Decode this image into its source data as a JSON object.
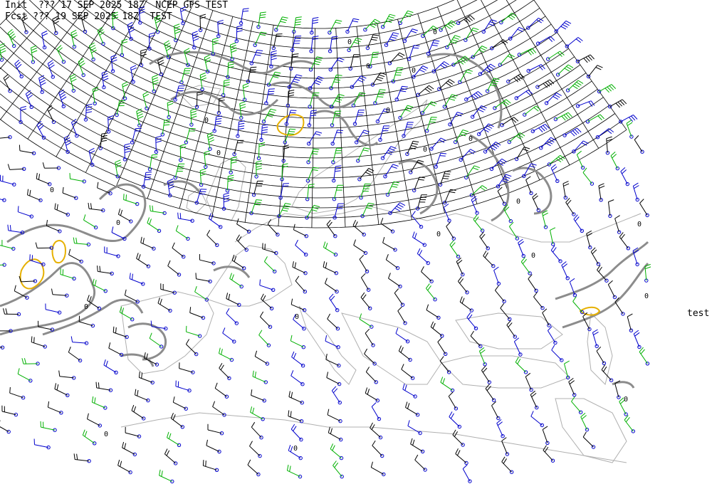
{
  "header": {
    "line1": "Init  ??? 17 SEP 2025 18Z  NCEP GFS TEST",
    "line2": "Fcst ??? 19 SEP 2025 18Z  TEST"
  },
  "side_label": "test",
  "contour_labels": [
    "0",
    "0",
    "0",
    "0",
    "0",
    "0",
    "0",
    "0",
    "0",
    "0",
    "0",
    "0",
    "0",
    "0",
    "0",
    "0",
    "0",
    "0",
    "0",
    "0",
    "0"
  ],
  "colors": {
    "background": "#ffffff",
    "coastline": "#b0b0b0",
    "gray_contour": "#8c8c8c",
    "yellow_contour": "#e6b000",
    "barb_black": "#000000",
    "barb_green": "#00b000",
    "barb_blue": "#0000cc",
    "grid": "#000000"
  },
  "map": {
    "projection": "polar stereographic",
    "region": "Europe / North Atlantic",
    "layers": [
      "wind barbs",
      "cloud contours",
      "precip contour",
      "lat-lon grid",
      "coastlines"
    ]
  }
}
